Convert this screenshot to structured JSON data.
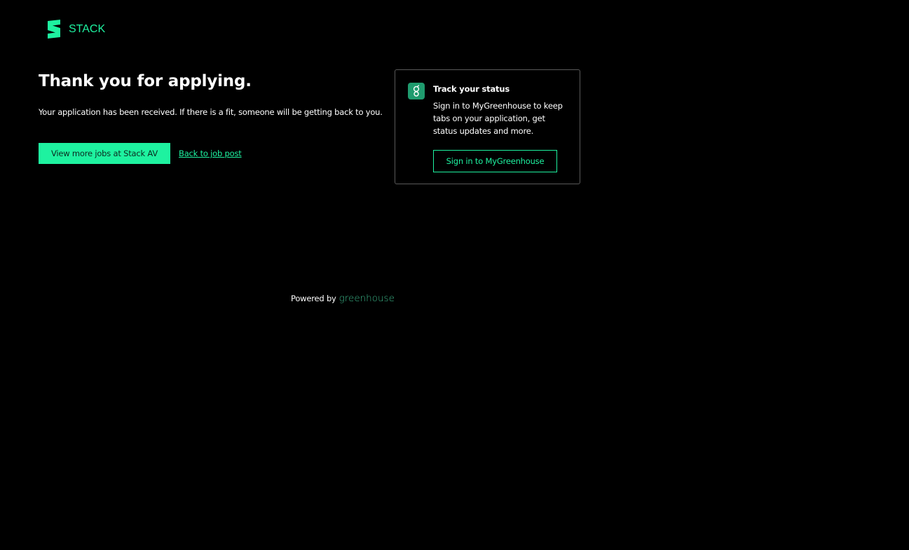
{
  "header": {
    "logo_text": "STACK",
    "logo_icon": "stack-logo-icon"
  },
  "main": {
    "heading": "Thank you for applying.",
    "message": "Your application has been received. If there is a fit, someone will be getting back to you.",
    "primary_button_label": "View more jobs at Stack AV",
    "back_link_label": "Back to job post"
  },
  "status_card": {
    "icon": "greenhouse-g-icon",
    "title": "Track your status",
    "text": "Sign in to MyGreenhouse to keep tabs on your application, get status updates and more.",
    "button_label": "Sign in to MyGreenhouse"
  },
  "footer": {
    "powered_by": "Powered by",
    "brand": "greenhouse"
  },
  "colors": {
    "background": "#000000",
    "accent": "#1ef2a0",
    "greenhouse_green": "#1f9b6e",
    "card_border": "#5a5a5a"
  }
}
